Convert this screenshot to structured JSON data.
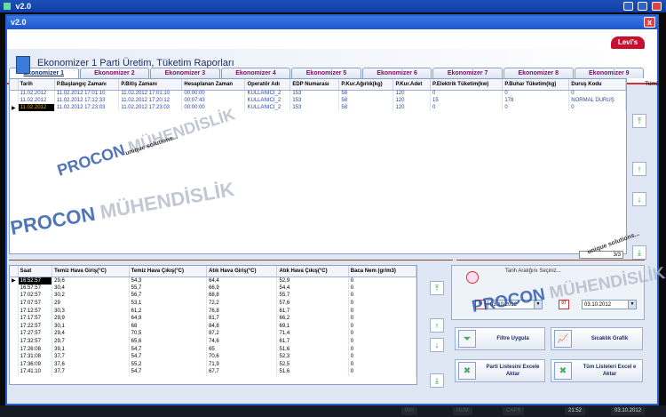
{
  "outer": {
    "title": "v2.0"
  },
  "window": {
    "title": "v2.0",
    "close_label": "x"
  },
  "header": {
    "brand": "Levi's",
    "title": "Ekonomizer 1 Parti Üretim, Tüketim Raporları"
  },
  "tabs": [
    "Ekonomizer 1",
    "Ekonomizer 2",
    "Ekonomizer 3",
    "Ekonomizer 4",
    "Ekonomizer 5",
    "Ekonomizer 6",
    "Ekonomizer 7",
    "Ekonomizer 8",
    "Ekonomizer 9"
  ],
  "top_table": {
    "headers": [
      "Tarih",
      "P.Başlangıç Zamanı",
      "P.Bitiş Zamanı",
      "Hesaplanan Zaman",
      "Operatör Adı",
      "EDP Numarası",
      "P.Kur.Ağırlık(kg)",
      "P.Kur.Adet",
      "P.Elektrik Tüketim(kw)",
      "P.Buhar Tüketim(kg)",
      "Duruş Kodu"
    ],
    "rows": [
      [
        "11.02.2012",
        "11.02.2012 17:01:10",
        "11.02.2012 17:01:10",
        "00:00:00",
        "KULLANICI_2",
        "153",
        "58",
        "120",
        "0",
        "0",
        "0"
      ],
      [
        "11.02.2012",
        "11.02.2012 17:12:33",
        "11.02.2012 17:20:12",
        "00:07:43",
        "KULLANICI_2",
        "153",
        "58",
        "120",
        "15",
        "178",
        "NORMAL DURUŞ"
      ],
      [
        "11.02.2012",
        "11.02.2012 17:23:03",
        "11.02.2012 17:23:03",
        "00:00:00",
        "KULLANICI_2",
        "153",
        "58",
        "120",
        "0",
        "0",
        "0"
      ]
    ]
  },
  "side_labels": {
    "tumu": "Tümü"
  },
  "counter": "3/3",
  "bottom_table": {
    "headers": [
      "Saat",
      "Temiz Hava Giriş(°C)",
      "Temiz Hava Çıkış(°C)",
      "Atık Hava Giriş(°C)",
      "Atık Hava Çıkış(°C)",
      "Baca Nem (gr/m3)"
    ],
    "rows": [
      [
        "16:52:57",
        "29,6",
        "54,3",
        "64,4",
        "52,9",
        "0"
      ],
      [
        "16:57:57",
        "30,4",
        "55,7",
        "66,9",
        "54,4",
        "0"
      ],
      [
        "17:02:57",
        "30,2",
        "56,7",
        "68,8",
        "55,7",
        "0"
      ],
      [
        "17:07:57",
        "29",
        "53,1",
        "72,2",
        "57,6",
        "0"
      ],
      [
        "17:12:57",
        "30,3",
        "61,2",
        "76,8",
        "61,7",
        "0"
      ],
      [
        "17:17:57",
        "29,9",
        "64,9",
        "81,7",
        "66,2",
        "0"
      ],
      [
        "17:22:57",
        "30,1",
        "68",
        "84,8",
        "69,1",
        "0"
      ],
      [
        "17:27:57",
        "29,4",
        "70,5",
        "87,2",
        "71,4",
        "0"
      ],
      [
        "17:32:57",
        "29,7",
        "65,6",
        "74,6",
        "61,7",
        "0"
      ],
      [
        "17:26:08",
        "39,1",
        "54,7",
        "65",
        "51,6",
        "0"
      ],
      [
        "17:31:08",
        "37,7",
        "54,7",
        "70,6",
        "52,3",
        "0"
      ],
      [
        "17:36:09",
        "37,6",
        "55,2",
        "71,9",
        "52,5",
        "0"
      ],
      [
        "17:41:10",
        "37,7",
        "54,7",
        "67,7",
        "51,6",
        "0"
      ]
    ]
  },
  "filter": {
    "legend": "Tarih Aralığını Seçiniz...",
    "start_date": "03.10.2012",
    "end_date": "03.10.2012",
    "cal_label": "07"
  },
  "buttons": {
    "filter": "Filtre Uygula",
    "chart": "Sıcaklık Grafik",
    "export_party": "Parti Listesini Excele Aktar",
    "export_all": "Tüm Listeleri Excel e Aktar"
  },
  "watermark": {
    "brand1": "PROCON",
    "brand2": "MÜHENDİSLİK",
    "slogan": "unique solutions..."
  },
  "taskbar": {
    "ins": "INS",
    "num": "NUM",
    "caps": "CAPS",
    "time": "21:52",
    "date": "03.10.2012"
  }
}
